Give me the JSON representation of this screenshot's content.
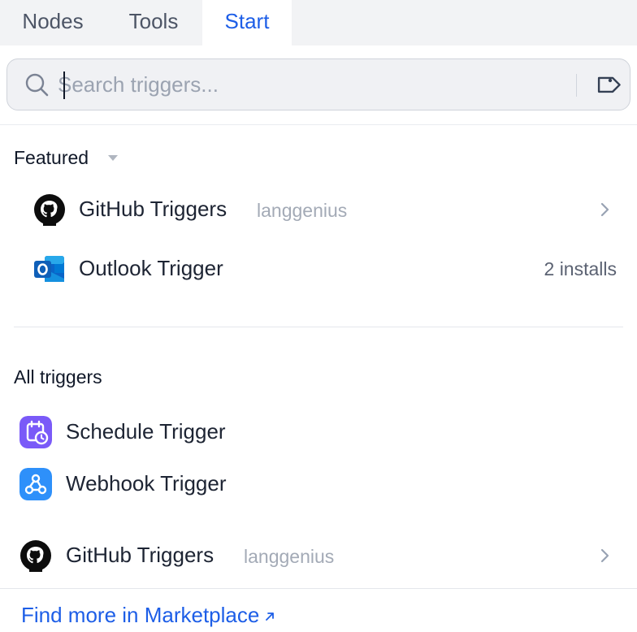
{
  "tabs": [
    {
      "label": "Nodes",
      "active": false
    },
    {
      "label": "Tools",
      "active": false
    },
    {
      "label": "Start",
      "active": true
    }
  ],
  "search": {
    "value": "",
    "placeholder": "Search triggers..."
  },
  "featured": {
    "title": "Featured",
    "items": [
      {
        "name": "GitHub Triggers",
        "author": "langgenius",
        "icon": "github-icon",
        "action": "chevron-right-icon"
      },
      {
        "name": "Outlook Trigger",
        "meta": "2 installs",
        "icon": "outlook-icon"
      }
    ]
  },
  "all": {
    "title": "All triggers",
    "items": [
      {
        "name": "Schedule Trigger",
        "icon": "schedule-icon",
        "color": "#7a5af8"
      },
      {
        "name": "Webhook Trigger",
        "icon": "webhook-icon",
        "color": "#2e90fa"
      },
      {
        "name": "GitHub Triggers",
        "author": "langgenius",
        "icon": "github-icon",
        "action": "chevron-right-icon"
      }
    ]
  },
  "marketplace": {
    "label": "Find more in Marketplace",
    "icon": "arrow-up-right-icon"
  },
  "colors": {
    "accent": "#1d5ee7",
    "tabbar_bg": "#f2f3f5"
  }
}
